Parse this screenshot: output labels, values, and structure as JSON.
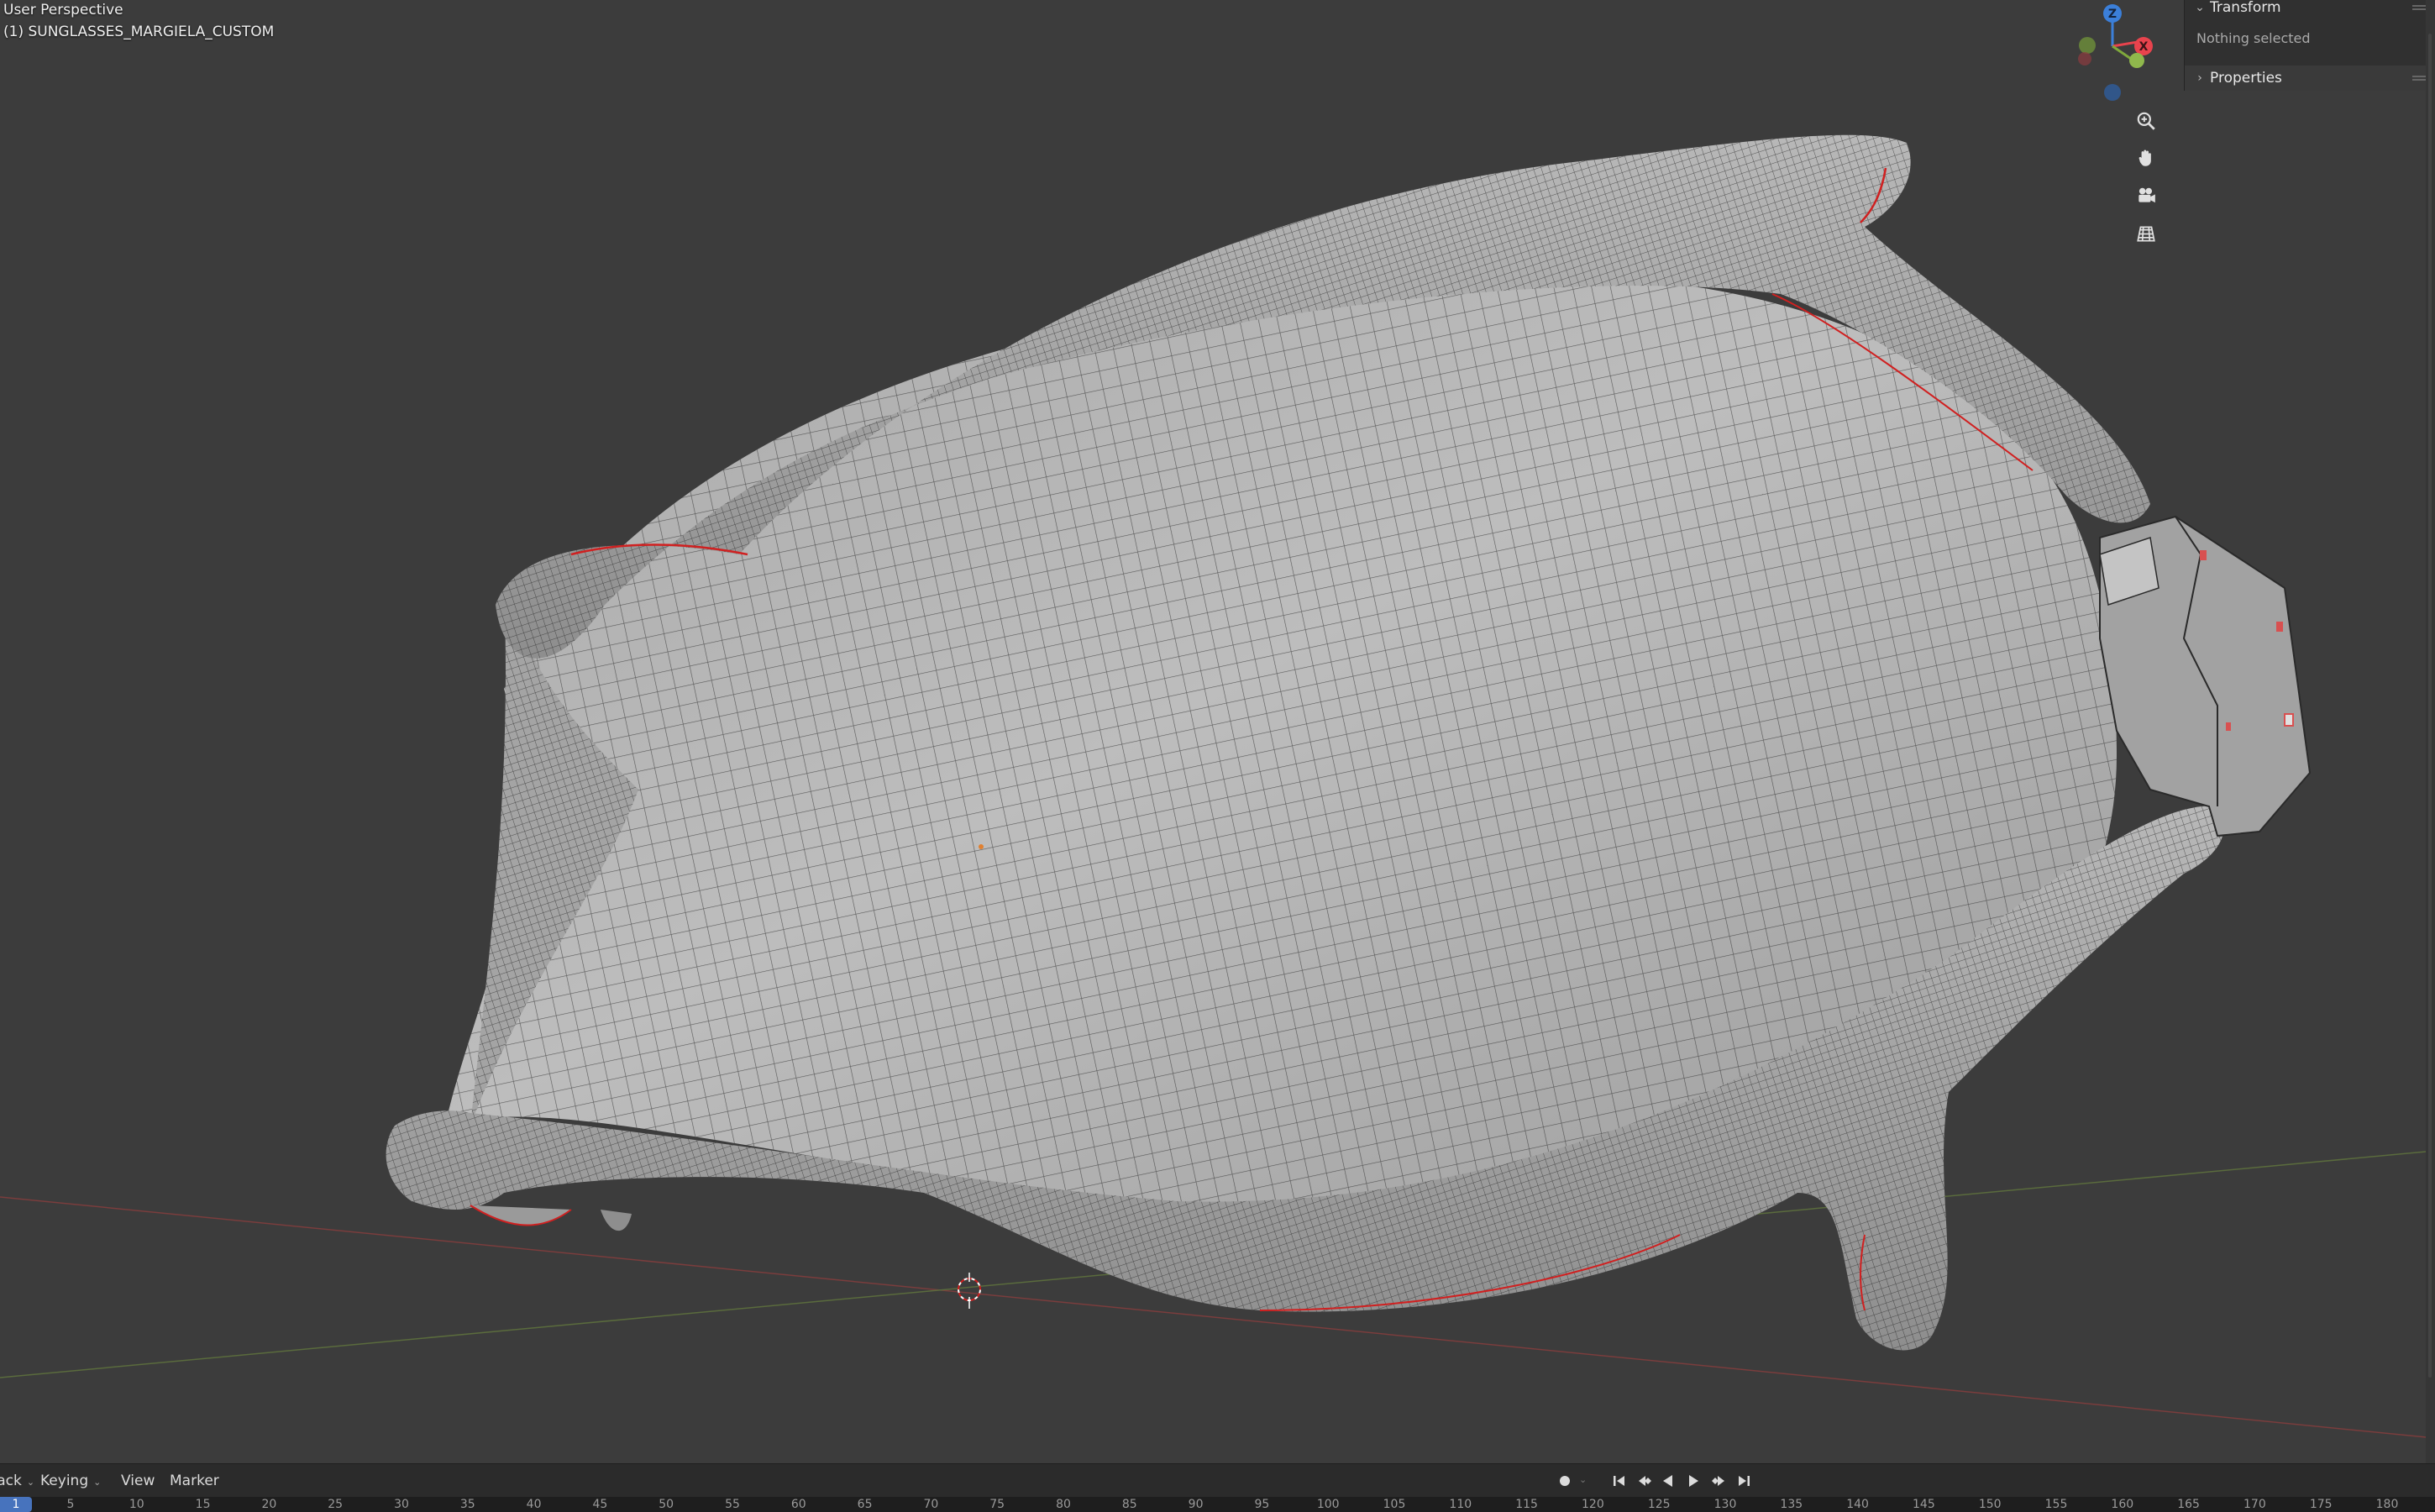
{
  "viewport": {
    "view_mode": "User Perspective",
    "object_name": "(1) SUNGLASSES_MARGIELA_CUSTOM",
    "gizmo_axes": [
      "Z",
      "X"
    ]
  },
  "sidebar": {
    "transform_label": "Transform",
    "nothing_selected": "Nothing selected",
    "properties_label": "Properties"
  },
  "timeline": {
    "menus": {
      "playback": "Playback",
      "keying": "Keying",
      "view": "View",
      "marker": "Marker"
    },
    "current_frame": "1",
    "ruler_ticks": [
      "5",
      "10",
      "15",
      "20",
      "25",
      "30",
      "35",
      "40",
      "45",
      "50",
      "55",
      "60",
      "65",
      "70",
      "75",
      "80",
      "85",
      "90",
      "95",
      "100",
      "105",
      "110",
      "115",
      "120",
      "125",
      "130",
      "135",
      "140",
      "145",
      "150",
      "155",
      "160",
      "165",
      "170",
      "175",
      "180"
    ]
  },
  "colors": {
    "viewport_bg": "#3c3c3c",
    "mesh_fill": "#b5b5b5",
    "wire": "#2a2a2a",
    "seam": "#d02020",
    "x_axis": "#e8434d",
    "y_axis": "#7fa83c",
    "z_axis": "#3b7fd9",
    "frame_highlight": "#4773bd"
  },
  "icons": {
    "zoom": "zoom-icon",
    "pan": "hand-icon",
    "camera": "camera-icon",
    "ortho": "grid-icon"
  }
}
